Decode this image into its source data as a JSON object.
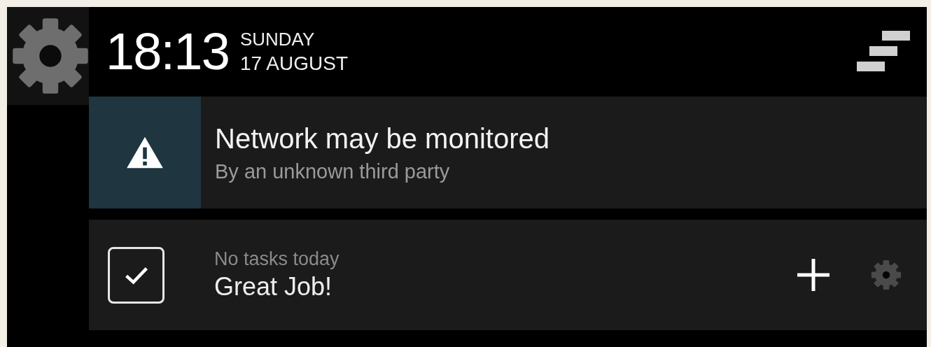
{
  "header": {
    "time": "18:13",
    "day": "SUNDAY",
    "date": "17 AUGUST"
  },
  "notifications": [
    {
      "kind": "warning",
      "title": "Network may be monitored",
      "subtitle": "By an unknown third party"
    },
    {
      "kind": "tasks",
      "checked": true,
      "subtitle": "No tasks today",
      "title": "Great Job!"
    }
  ]
}
